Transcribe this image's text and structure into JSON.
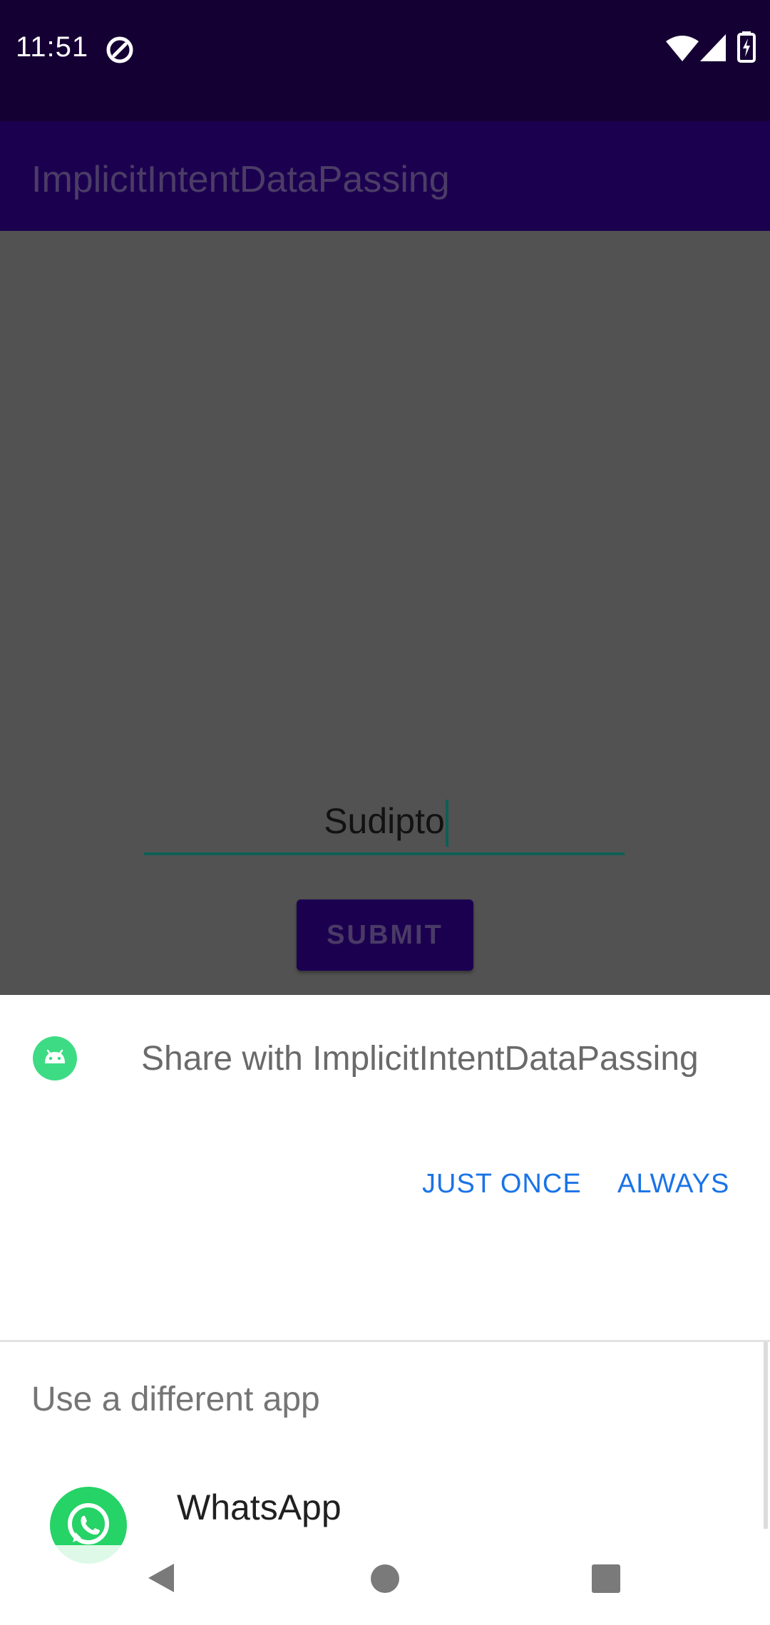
{
  "status_bar": {
    "time": "11:51",
    "icons": [
      "sync-icon",
      "wifi-icon",
      "signal-icon",
      "battery-charging-icon"
    ]
  },
  "app_bar": {
    "title": "ImplicitIntentDataPassing"
  },
  "form": {
    "input_value": "Sudipto",
    "submit_label": "SUBMIT"
  },
  "share_sheet": {
    "title": "Share with ImplicitIntentDataPassing",
    "icon": "android-app-icon",
    "just_once_label": "JUST ONCE",
    "always_label": "ALWAYS",
    "different_app_label": "Use a different app",
    "apps": [
      {
        "name": "WhatsApp",
        "icon": "whatsapp-icon"
      }
    ]
  },
  "navigation": {
    "icons": [
      "back-icon",
      "home-icon",
      "recents-icon"
    ]
  },
  "colors": {
    "status_bar": "#150033",
    "app_bar": "#1c0050",
    "scrim_background": "#525252",
    "accent_blue": "#1a73e8",
    "input_underline": "#0d5f55",
    "whatsapp_green": "#25d366"
  }
}
